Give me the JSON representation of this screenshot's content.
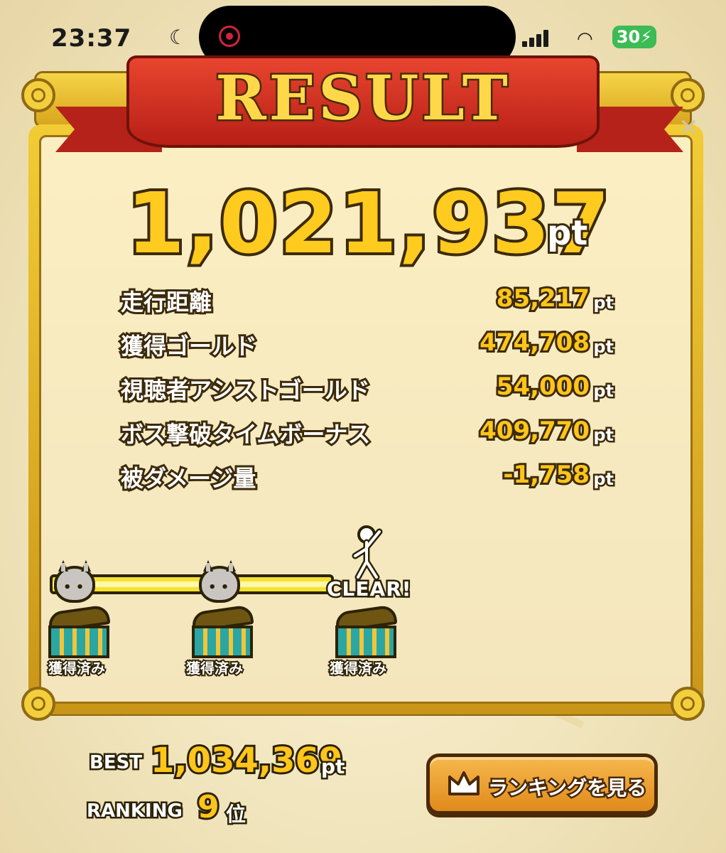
{
  "status_bar": {
    "time": "23:37",
    "battery": "30"
  },
  "header": {
    "title": "RESULT"
  },
  "total": {
    "score": "1,021,937",
    "unit": "pt"
  },
  "breakdown": [
    {
      "label": "走行距離",
      "value": "85,217",
      "unit": "pt"
    },
    {
      "label": "獲得ゴールド",
      "value": "474,708",
      "unit": "pt"
    },
    {
      "label": "視聴者アシストゴールド",
      "value": "54,000",
      "unit": "pt"
    },
    {
      "label": "ボス撃破タイムボーナス",
      "value": "409,770",
      "unit": "pt"
    },
    {
      "label": "被ダメージ量",
      "value": "-1,758",
      "unit": "pt"
    }
  ],
  "progress": {
    "clear_label": "CLEAR!",
    "chest_label": "獲得済み"
  },
  "best": {
    "label": "BEST",
    "value": "1,034,369",
    "unit": "pt"
  },
  "ranking": {
    "label": "RANKING",
    "value": "9",
    "unit": "位",
    "button_label": "ランキングを見る"
  },
  "colors": {
    "gold": "#ffc51a",
    "ribbon_red": "#c2261c",
    "frame_gold": "#f2cc35",
    "button_orange": "#e08a1c"
  }
}
